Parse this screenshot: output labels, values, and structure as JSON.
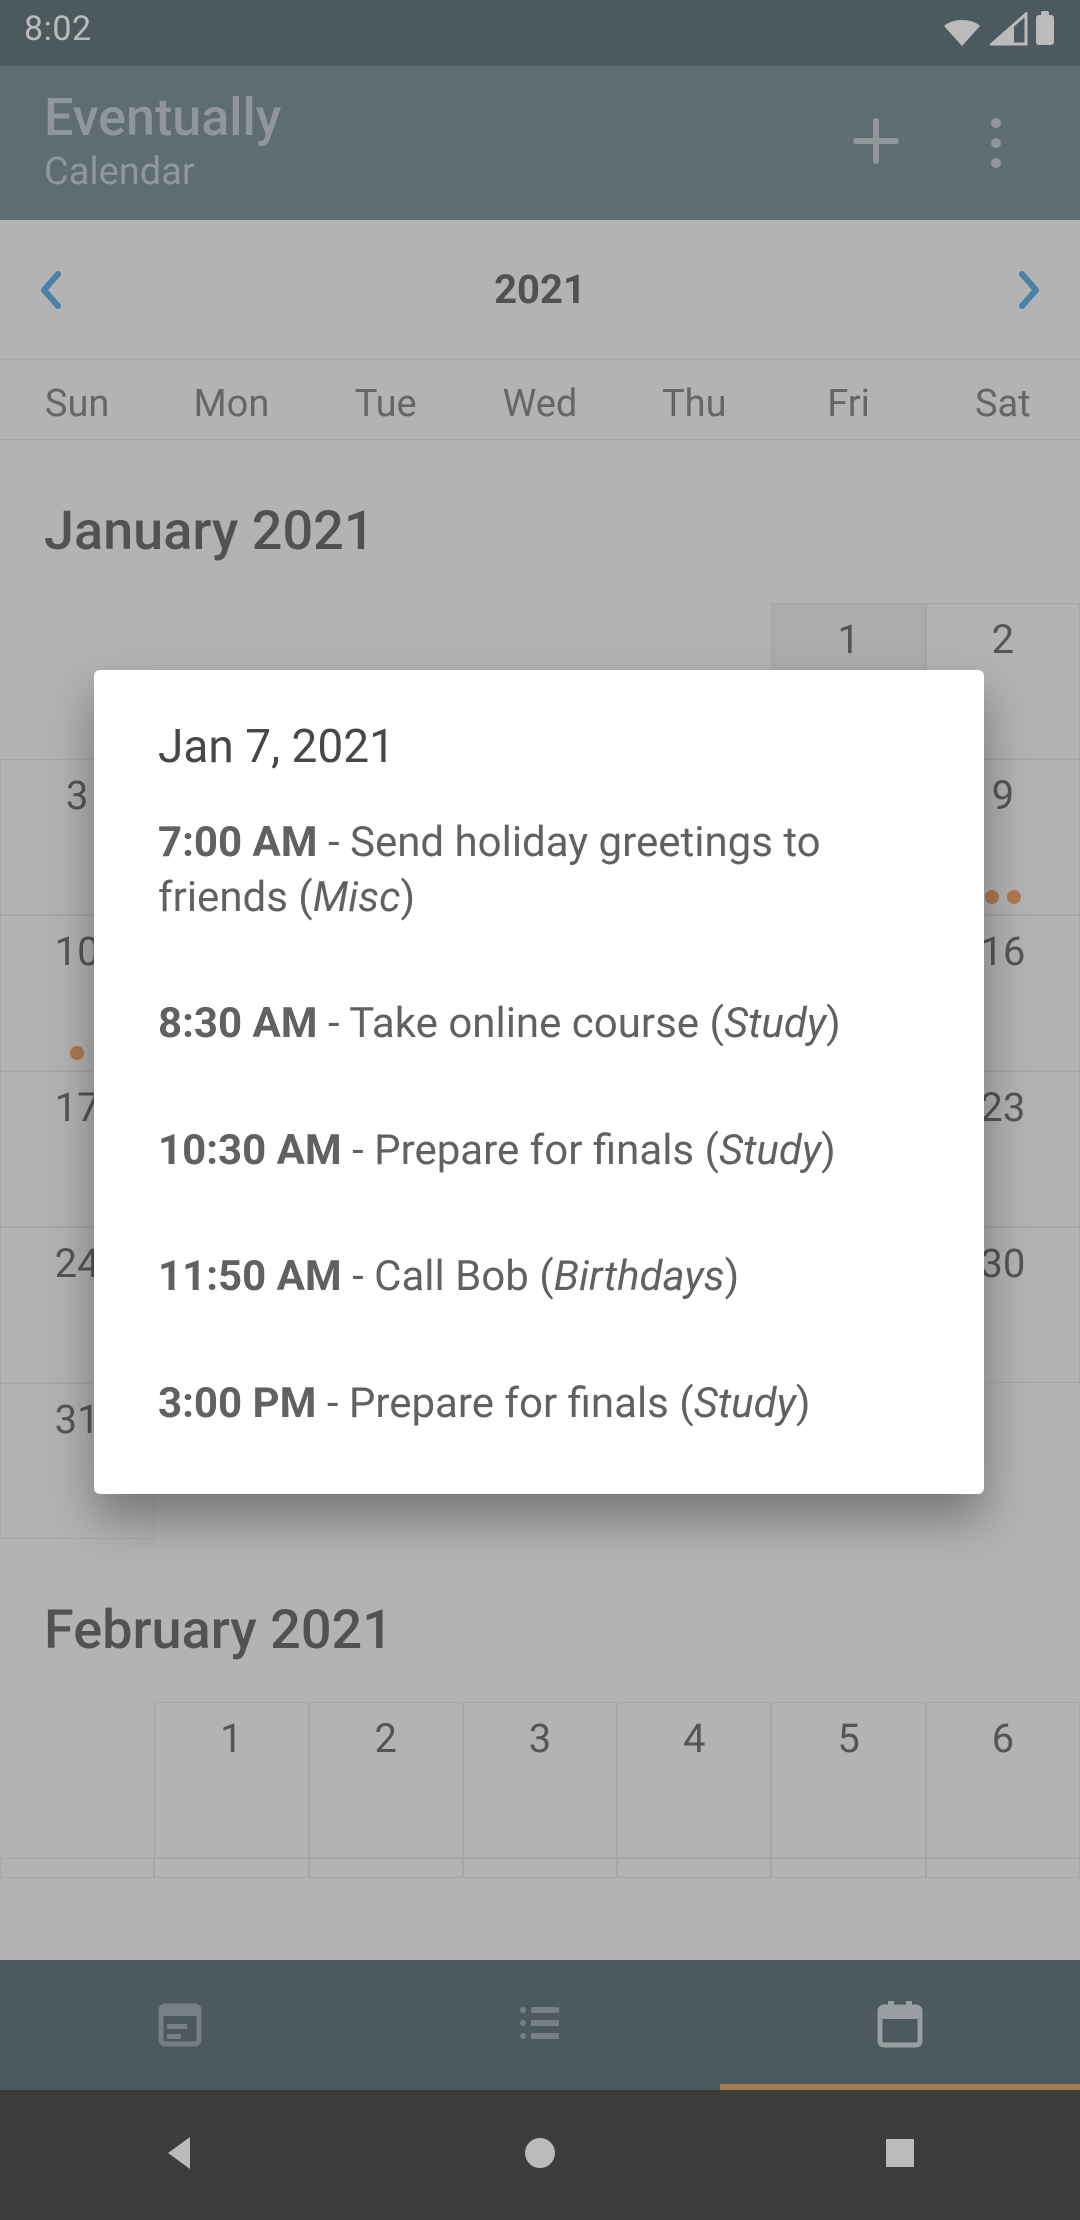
{
  "status_bar": {
    "time": "8:02"
  },
  "app_bar": {
    "title": "Eventually",
    "subtitle": "Calendar"
  },
  "year_header": {
    "year": "2021"
  },
  "weekdays": [
    "Sun",
    "Mon",
    "Tue",
    "Wed",
    "Thu",
    "Fri",
    "Sat"
  ],
  "months": {
    "january": {
      "label": "January 2021",
      "leading_blanks": 5,
      "days": 31,
      "today": 1,
      "event_dots": {
        "9": 2,
        "10": 1
      }
    },
    "february": {
      "label": "February 2021",
      "leading_blanks": 1,
      "days_shown_row1": [
        1,
        2,
        3,
        4,
        5,
        6
      ]
    }
  },
  "dialog": {
    "date_label": "Jan 7, 2021",
    "events": [
      {
        "time": "7:00 AM",
        "sep": " - ",
        "title": "Send holiday greetings to friends",
        "cat_open": " (",
        "category": "Misc",
        "cat_close": ")"
      },
      {
        "time": "8:30 AM",
        "sep": " - ",
        "title": "Take online course",
        "cat_open": " (",
        "category": "Study",
        "cat_close": ")"
      },
      {
        "time": "10:30 AM",
        "sep": " - ",
        "title": "Prepare for finals",
        "cat_open": " (",
        "category": "Study",
        "cat_close": ")"
      },
      {
        "time": "11:50 AM",
        "sep": " - ",
        "title": "Call Bob",
        "cat_open": " (",
        "category": "Birthdays",
        "cat_close": ")"
      },
      {
        "time": "3:00 PM",
        "sep": " - ",
        "title": "Prepare for finals",
        "cat_open": " (",
        "category": "Study",
        "cat_close": ")"
      }
    ]
  },
  "colors": {
    "status_bg": "#203a45",
    "appbar_bg": "#446371",
    "accent_orange": "#e97d29",
    "accent_blue": "#1d8ad5"
  }
}
